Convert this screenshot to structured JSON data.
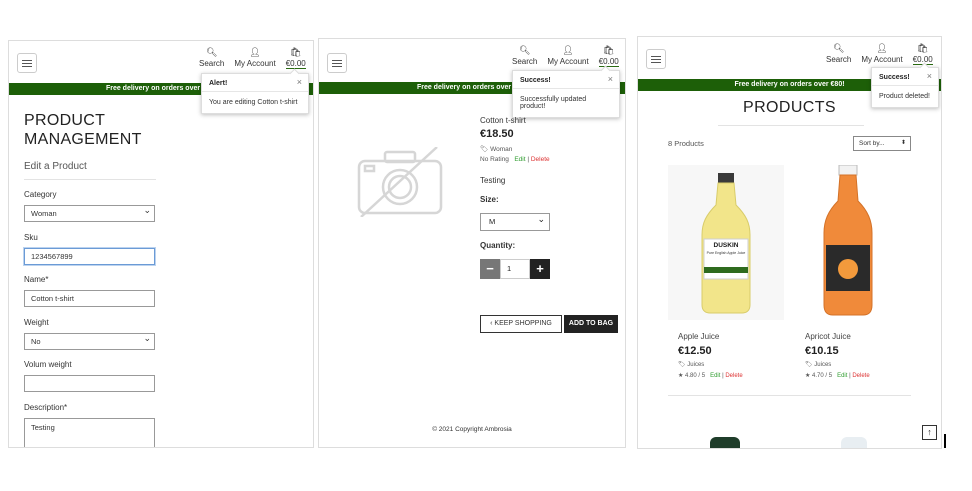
{
  "nav": {
    "search_label": "Search",
    "account_label": "My Account",
    "bag_total": "€0.00",
    "icons": [
      "menu-icon",
      "search-icon",
      "user-icon",
      "shopping-bag-icon"
    ]
  },
  "shipping_banner": "Free delivery on orders over €80!",
  "panel_edit": {
    "toast": {
      "title": "Alert!",
      "close": "×",
      "message": "You are editing Cotton t-shirt"
    },
    "title_line1": "PRODUCT",
    "title_line2": "MANAGEMENT",
    "subtitle": "Edit a Product",
    "fields": {
      "category": {
        "label": "Category",
        "value": "Woman"
      },
      "sku": {
        "label": "Sku",
        "value": "1234567899"
      },
      "name": {
        "label": "Name*",
        "value": "Cotton t-shirt"
      },
      "weight": {
        "label": "Weight",
        "value": "No"
      },
      "volume_weight": {
        "label": "Volum weight",
        "value": ""
      },
      "description": {
        "label": "Description*",
        "value": "Testing"
      }
    }
  },
  "panel_detail": {
    "toast": {
      "title": "Success!",
      "close": "×",
      "message": "Successfully updated product!"
    },
    "product_name": "Cotton t-shirt",
    "price": "€18.50",
    "category": "Woman",
    "rating": "No Rating",
    "edit": "Edit",
    "separator": "|",
    "delete": "Delete",
    "description": "Testing",
    "size_label": "Size:",
    "size_value": "M",
    "quantity_label": "Quantity:",
    "quantity_minus": "−",
    "quantity_value": "1",
    "quantity_plus": "+",
    "keep_shopping": "KEEP SHOPPING",
    "add_to_bag": "ADD TO BAG",
    "copyright": "© 2021 Copyright Ambrosia"
  },
  "panel_products": {
    "toast": {
      "title": "Success!",
      "close": "×",
      "message": "Product deleted!"
    },
    "title": "PRODUCTS",
    "count": "8 Products",
    "sort_by": "Sort by...",
    "products": [
      {
        "name": "Apple Juice",
        "price": "€12.50",
        "category": "Juices",
        "rating": "4.80 / 5",
        "edit": "Edit",
        "delete": "Delete",
        "label_brand": "DUSKIN",
        "label_sub": "Pure English Apple Juice",
        "color": "#f2e58a"
      },
      {
        "name": "Apricot Juice",
        "price": "€10.15",
        "category": "Juices",
        "rating": "4.70 / 5",
        "edit": "Edit",
        "delete": "Delete",
        "color": "#f08a3a"
      }
    ],
    "back_to_top": "↑"
  },
  "colors": {
    "brand_green": "#1d5f08",
    "edit_green": "#2f9d2f",
    "delete_red": "#dd3333",
    "dark_button": "#222222"
  }
}
